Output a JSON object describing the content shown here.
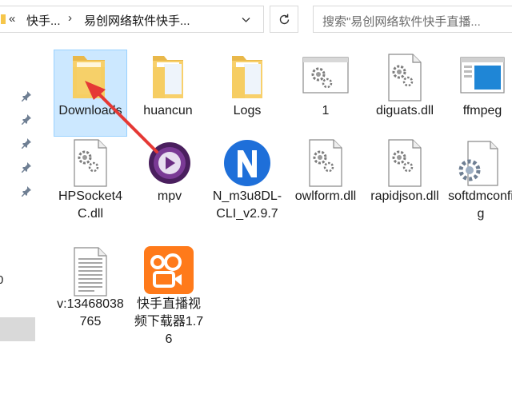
{
  "address_bar": {
    "back_glyph": "«",
    "crumbs": [
      "快手...",
      "易创网络软件快手..."
    ],
    "separator": "›"
  },
  "search": {
    "placeholder": "搜索\"易创网络软件快手直播..."
  },
  "nav": {
    "pin_count": 5,
    "partial_text": "0"
  },
  "files": [
    {
      "label": "Downloads",
      "icon": "folder-icon",
      "selected": true
    },
    {
      "label": "huancun",
      "icon": "folder-icon"
    },
    {
      "label": "Logs",
      "icon": "folder-icon"
    },
    {
      "label": "1",
      "icon": "window-file-icon"
    },
    {
      "label": "diguats.dll",
      "icon": "dll-file-icon"
    },
    {
      "label": "ffmpeg",
      "icon": "app-window-icon"
    },
    {
      "label": "HPSocket4C.dll",
      "icon": "dll-file-icon"
    },
    {
      "label": "mpv",
      "icon": "mpv-app-icon"
    },
    {
      "label": "N_m3u8DL-CLI_v2.9.7",
      "icon": "n-app-icon"
    },
    {
      "label": "owlform.dll",
      "icon": "dll-file-icon"
    },
    {
      "label": "rapidjson.dll",
      "icon": "dll-file-icon"
    },
    {
      "label": "softdmconfig",
      "icon": "config-file-icon"
    },
    {
      "label": "v:13468038765",
      "icon": "text-file-icon"
    },
    {
      "label": "快手直播视频下载器1.76",
      "icon": "kuaishou-app-icon"
    }
  ],
  "colors": {
    "folder": "#f8d06b",
    "selection": "#cce8ff",
    "arrow": "#e53935",
    "kuaishou": "#ff7a1a",
    "n_app": "#1e6fd9",
    "mpv": "#6b2d82"
  }
}
